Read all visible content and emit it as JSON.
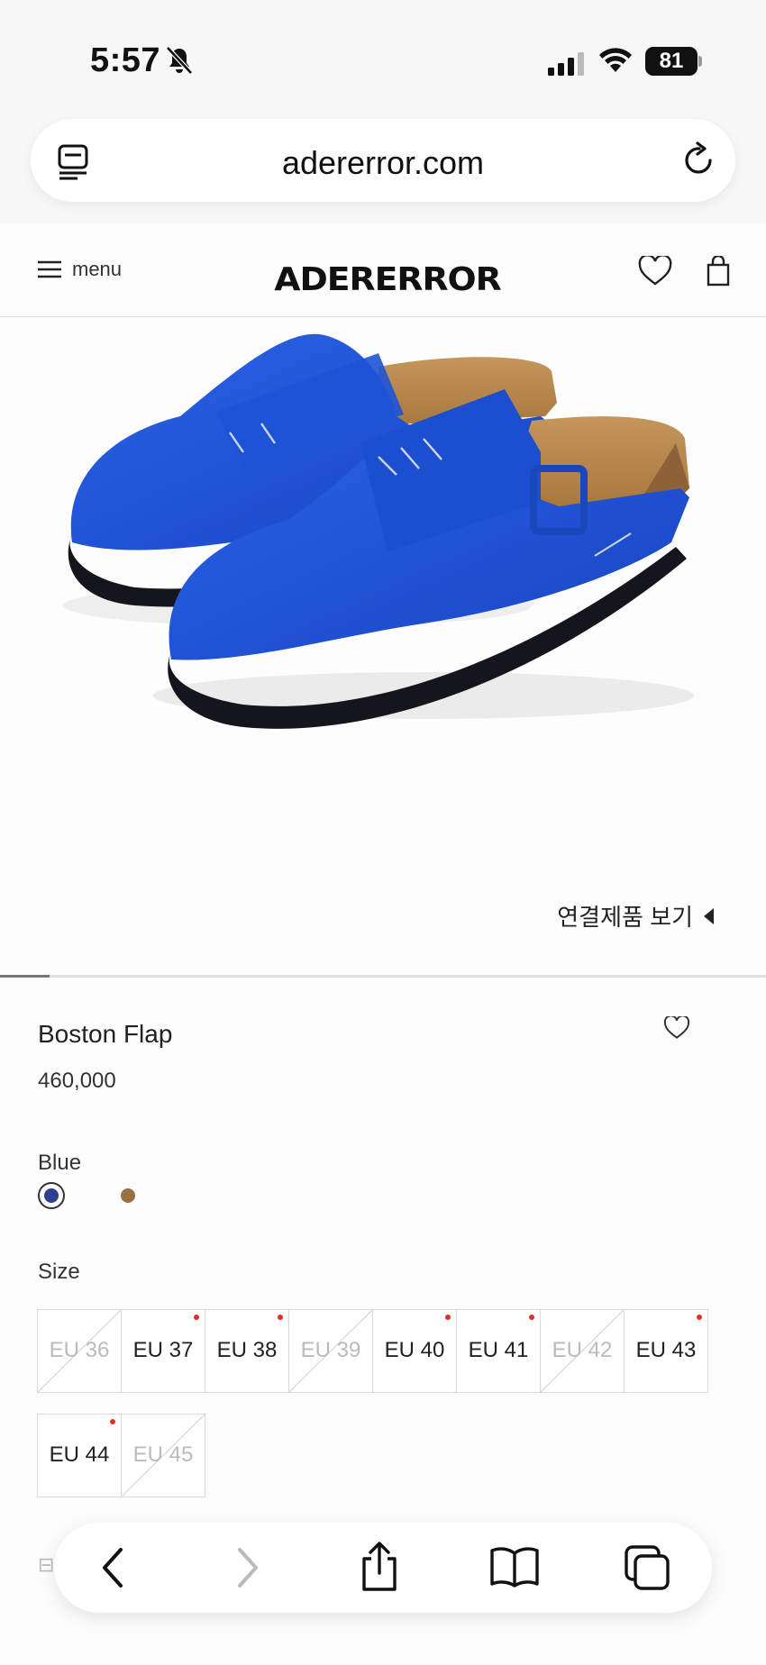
{
  "status_bar": {
    "time": "5:57",
    "battery": "81"
  },
  "browser": {
    "url": "adererror.com"
  },
  "header": {
    "menu_label": "menu",
    "logo": "ADERERROR"
  },
  "gallery": {
    "related_label": "연결제품 보기",
    "progress": 0.065
  },
  "product": {
    "name": "Boston Flap",
    "price": "460,000",
    "color_label": "Blue",
    "colors": [
      {
        "name": "Blue",
        "hex": "#2e3f8f",
        "selected": true
      },
      {
        "name": "Brown",
        "hex": "#9b7043",
        "selected": false
      }
    ],
    "size_label": "Size",
    "sizes": [
      {
        "label": "EU 36",
        "available": false,
        "low_stock": false
      },
      {
        "label": "EU 37",
        "available": true,
        "low_stock": true
      },
      {
        "label": "EU 38",
        "available": true,
        "low_stock": true
      },
      {
        "label": "EU 39",
        "available": false,
        "low_stock": false
      },
      {
        "label": "EU 40",
        "available": true,
        "low_stock": true
      },
      {
        "label": "EU 41",
        "available": true,
        "low_stock": true
      },
      {
        "label": "EU 42",
        "available": false,
        "low_stock": false
      },
      {
        "label": "EU 43",
        "available": true,
        "low_stock": true
      },
      {
        "label": "EU 44",
        "available": true,
        "low_stock": true
      },
      {
        "label": "EU 45",
        "available": false,
        "low_stock": false
      }
    ]
  },
  "colors": {
    "accent_dot": "#e0302c",
    "text": "#222222",
    "shoe_blue": "#1f52d6"
  },
  "icons": [
    "bell-slash-icon",
    "signal-icon",
    "wifi-icon",
    "tabs-icon",
    "reload-icon",
    "hamburger-icon",
    "heart-icon",
    "bag-icon",
    "back-icon",
    "forward-icon",
    "share-icon",
    "bookmarks-icon",
    "tab-overview-icon"
  ]
}
